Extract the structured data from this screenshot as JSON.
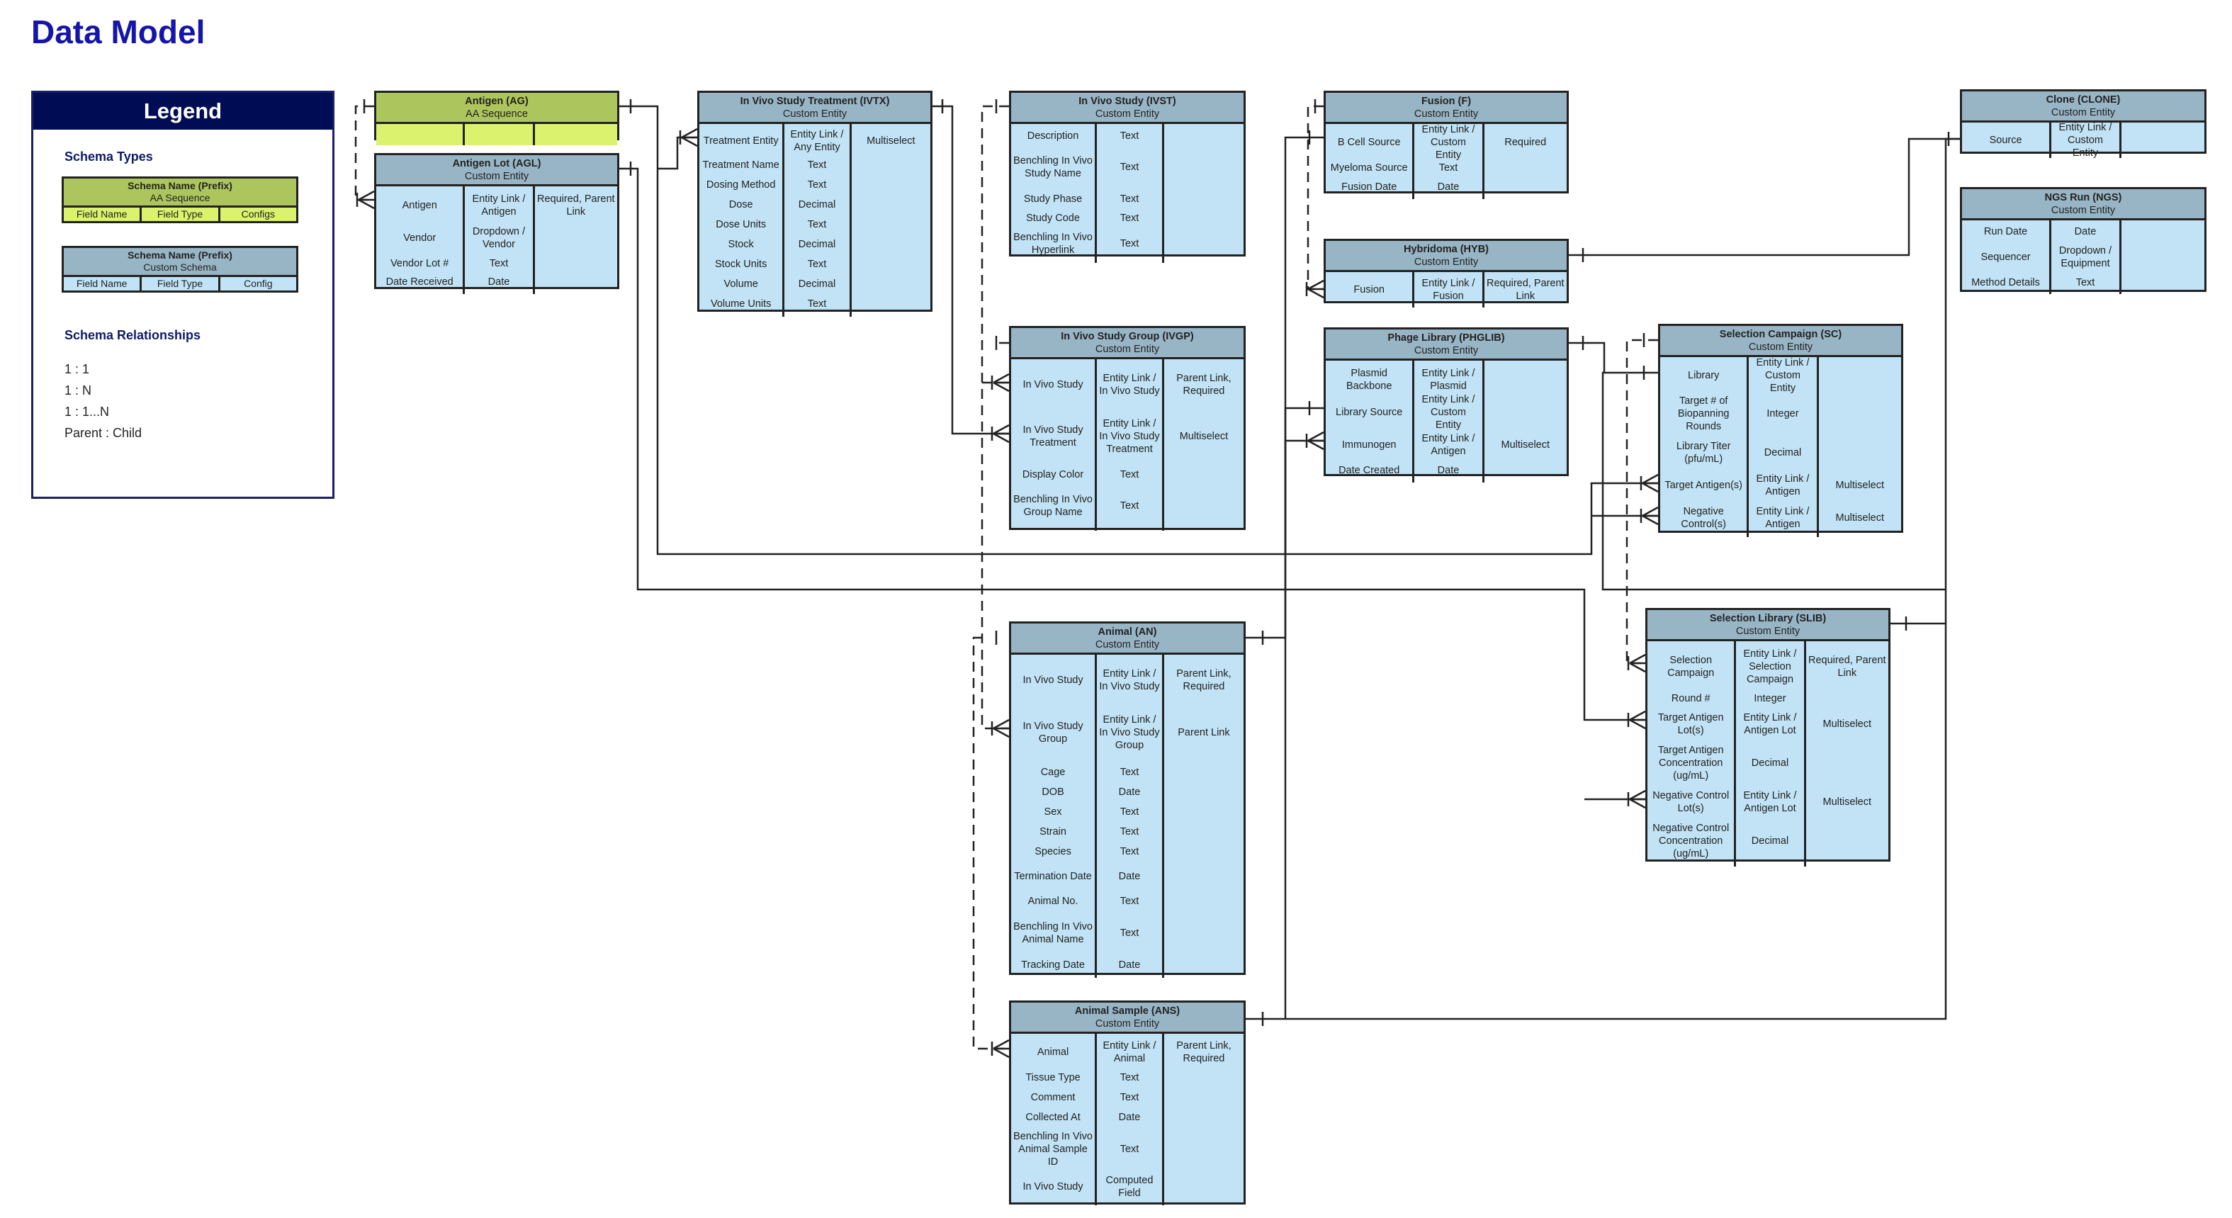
{
  "page": {
    "title": "Data Model"
  },
  "legend": {
    "title": "Legend",
    "schema_types_label": "Schema Types",
    "aa_example": {
      "name": "Schema Name (Prefix)",
      "type": "AA Sequence",
      "cols": [
        "Field Name",
        "Field Type",
        "Configs"
      ]
    },
    "custom_example": {
      "name": "Schema Name (Prefix)",
      "type": "Custom Schema",
      "cols": [
        "Field Name",
        "Field Type",
        "Config"
      ]
    },
    "relationships_label": "Schema Relationships",
    "relationships": [
      {
        "label": "1 : 1",
        "kind": "one-one"
      },
      {
        "label": "1 : N",
        "kind": "one-many"
      },
      {
        "label": "1 : 1...N",
        "kind": "one-one-many"
      },
      {
        "label": "Parent : Child",
        "kind": "parent-child"
      }
    ]
  },
  "colors": {
    "title": "#1515a8",
    "legend_header": "#000d55",
    "aa_header": "#adc55d",
    "aa_body": "#daf26e",
    "custom_header": "#98b5c6",
    "custom_body": "#c1e3f5",
    "line": "#222222"
  },
  "entities": {
    "AG": {
      "name": "Antigen (AG)",
      "type": "AA Sequence",
      "rows": [
        [
          "",
          "",
          ""
        ]
      ]
    },
    "AGL": {
      "name": "Antigen Lot (AGL)",
      "type": "Custom Entity",
      "rows": [
        [
          "Antigen",
          "Entity Link / Antigen",
          "Required, Parent Link"
        ],
        [
          "Vendor",
          "Dropdown / Vendor",
          ""
        ],
        [
          "Vendor Lot #",
          "Text",
          ""
        ],
        [
          "Date Received",
          "Date",
          ""
        ]
      ]
    },
    "IVTX": {
      "name": "In Vivo Study Treatment (IVTX)",
      "type": "Custom Entity",
      "rows": [
        [
          "Treatment Entity",
          "Entity Link / Any Entity",
          "Multiselect"
        ],
        [
          "Treatment Name",
          "Text",
          ""
        ],
        [
          "Dosing Method",
          "Text",
          ""
        ],
        [
          "Dose",
          "Decimal",
          ""
        ],
        [
          "Dose Units",
          "Text",
          ""
        ],
        [
          "Stock",
          "Decimal",
          ""
        ],
        [
          "Stock Units",
          "Text",
          ""
        ],
        [
          "Volume",
          "Decimal",
          ""
        ],
        [
          "Volume Units",
          "Text",
          ""
        ]
      ]
    },
    "IVST": {
      "name": "In Vivo Study (IVST)",
      "type": "Custom Entity",
      "rows": [
        [
          "Description",
          "Text",
          ""
        ],
        [
          "Benchling In Vivo Study Name",
          "Text",
          ""
        ],
        [
          "Study Phase",
          "Text",
          ""
        ],
        [
          "Study Code",
          "Text",
          ""
        ],
        [
          "Benchling In Vivo Hyperlink",
          "Text",
          ""
        ]
      ]
    },
    "F": {
      "name": "Fusion (F)",
      "type": "Custom Entity",
      "rows": [
        [
          "B Cell Source",
          "Entity Link / Custom Entity",
          "Required"
        ],
        [
          "Myeloma Source",
          "Text",
          ""
        ],
        [
          "Fusion Date",
          "Date",
          ""
        ]
      ]
    },
    "HYB": {
      "name": "Hybridoma (HYB)",
      "type": "Custom Entity",
      "rows": [
        [
          "Fusion",
          "Entity Link / Fusion",
          "Required, Parent Link"
        ]
      ]
    },
    "PHGLIB": {
      "name": "Phage Library (PHGLIB)",
      "type": "Custom Entity",
      "rows": [
        [
          "Plasmid Backbone",
          "Entity Link / Plasmid",
          ""
        ],
        [
          "Library Source",
          "Entity Link / Custom Entity",
          ""
        ],
        [
          "Immunogen",
          "Entity Link / Antigen",
          "Multiselect"
        ],
        [
          "Date Created",
          "Date",
          ""
        ]
      ]
    },
    "CLONE": {
      "name": "Clone (CLONE)",
      "type": "Custom Entity",
      "rows": [
        [
          "Source",
          "Entity Link / Custom Entity",
          ""
        ]
      ]
    },
    "NGS": {
      "name": "NGS Run (NGS)",
      "type": "Custom Entity",
      "rows": [
        [
          "Run Date",
          "Date",
          ""
        ],
        [
          "Sequencer",
          "Dropdown / Equipment",
          ""
        ],
        [
          "Method Details",
          "Text",
          ""
        ]
      ]
    },
    "IVGP": {
      "name": "In Vivo Study Group (IVGP)",
      "type": "Custom Entity",
      "rows": [
        [
          "In Vivo Study",
          "Entity Link / In Vivo Study",
          "Parent Link, Required"
        ],
        [
          "In Vivo Study Treatment",
          "Entity Link / In Vivo Study Treatment",
          "Multiselect"
        ],
        [
          "Display Color",
          "Text",
          ""
        ],
        [
          "Benchling In Vivo Group Name",
          "Text",
          ""
        ]
      ]
    },
    "SC": {
      "name": "Selection Campaign (SC)",
      "type": "Custom Entity",
      "rows": [
        [
          "Library",
          "Entity Link / Custom Entity",
          ""
        ],
        [
          "Target # of Biopanning Rounds",
          "Integer",
          ""
        ],
        [
          "Library Titer (pfu/mL)",
          "Decimal",
          ""
        ],
        [
          "Target Antigen(s)",
          "Entity Link / Antigen",
          "Multiselect"
        ],
        [
          "Negative Control(s)",
          "Entity Link / Antigen",
          "Multiselect"
        ]
      ]
    },
    "AN": {
      "name": "Animal (AN)",
      "type": "Custom Entity",
      "rows": [
        [
          "In Vivo Study",
          "Entity Link / In Vivo Study",
          "Parent Link, Required"
        ],
        [
          "In Vivo Study Group",
          "Entity Link / In Vivo Study Group",
          "Parent Link"
        ],
        [
          "Cage",
          "Text",
          ""
        ],
        [
          "DOB",
          "Date",
          ""
        ],
        [
          "Sex",
          "Text",
          ""
        ],
        [
          "Strain",
          "Text",
          ""
        ],
        [
          "Species",
          "Text",
          ""
        ],
        [
          "Termination Date",
          "Date",
          ""
        ],
        [
          "Animal No.",
          "Text",
          ""
        ],
        [
          "Benchling In Vivo Animal Name",
          "Text",
          ""
        ],
        [
          "Tracking Date",
          "Date",
          ""
        ]
      ]
    },
    "ANS": {
      "name": "Animal Sample (ANS)",
      "type": "Custom Entity",
      "rows": [
        [
          "Animal",
          "Entity Link / Animal",
          "Parent Link, Required"
        ],
        [
          "Tissue Type",
          "Text",
          ""
        ],
        [
          "Comment",
          "Text",
          ""
        ],
        [
          "Collected At",
          "Date",
          ""
        ],
        [
          "Benchling In Vivo Animal Sample ID",
          "Text",
          ""
        ],
        [
          "In Vivo Study",
          "Computed Field",
          ""
        ]
      ]
    },
    "SLIB": {
      "name": "Selection Library (SLIB)",
      "type": "Custom Entity",
      "rows": [
        [
          "Selection Campaign",
          "Entity Link / Selection Campaign",
          "Required, Parent Link"
        ],
        [
          "Round #",
          "Integer",
          ""
        ],
        [
          "Target Antigen Lot(s)",
          "Entity Link / Antigen Lot",
          "Multiselect"
        ],
        [
          "Target Antigen Concentration (ug/mL)",
          "Decimal",
          ""
        ],
        [
          "Negative Control Lot(s)",
          "Entity Link / Antigen Lot",
          "Multiselect"
        ],
        [
          "Negative Control Concentration (ug/mL)",
          "Decimal",
          ""
        ]
      ]
    }
  },
  "relationships": [
    {
      "from": "AG",
      "to": "AGL.Antigen",
      "kind": "parent-child"
    },
    {
      "from": "AG",
      "to": "PHGLIB.Immunogen",
      "kind": "one-one-many"
    },
    {
      "from": "AG",
      "to": "SC.Target Antigen(s)",
      "kind": "one-one-many"
    },
    {
      "from": "AG",
      "to": "SC.Negative Control(s)",
      "kind": "one-one-many"
    },
    {
      "from": "AGL",
      "to": "IVTX.Treatment Entity",
      "kind": "one-one-many"
    },
    {
      "from": "AGL",
      "to": "SLIB.Target Antigen Lot(s)",
      "kind": "one-one-many"
    },
    {
      "from": "AGL",
      "to": "SLIB.Negative Control Lot(s)",
      "kind": "one-one-many"
    },
    {
      "from": "IVTX",
      "to": "IVGP.In Vivo Study Treatment",
      "kind": "one-one-many"
    },
    {
      "from": "IVST",
      "to": "IVGP.In Vivo Study",
      "kind": "parent-child"
    },
    {
      "from": "IVST",
      "to": "AN.In Vivo Study",
      "kind": "parent-child"
    },
    {
      "from": "IVGP",
      "to": "AN.In Vivo Study Group",
      "kind": "parent-child"
    },
    {
      "from": "AN",
      "to": "ANS.Animal",
      "kind": "parent-child"
    },
    {
      "from": "F",
      "to": "HYB.Fusion",
      "kind": "parent-child"
    },
    {
      "from": "AN",
      "to": "F.B Cell Source",
      "kind": "one-one"
    },
    {
      "from": "ANS",
      "to": "PHGLIB.Library Source",
      "kind": "one-one"
    },
    {
      "from": "HYB",
      "to": "CLONE.Source",
      "kind": "one-one"
    },
    {
      "from": "PHGLIB",
      "to": "SC.Library",
      "kind": "one-one"
    },
    {
      "from": "SC",
      "to": "SLIB.Selection Campaign",
      "kind": "parent-child"
    },
    {
      "from": "SLIB",
      "to": "CLONE.Source",
      "kind": "one-one"
    }
  ]
}
